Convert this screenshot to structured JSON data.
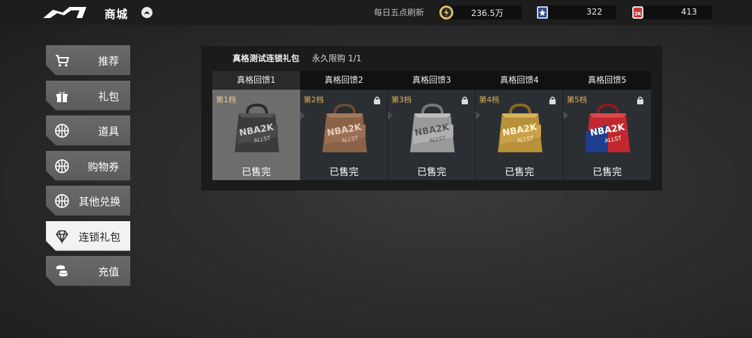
{
  "header": {
    "title": "商城",
    "refresh_text": "每日五点刷新",
    "currencies": [
      {
        "icon": "gold-coin-icon",
        "value": "236.5万"
      },
      {
        "icon": "allstar-token-icon",
        "value": "322"
      },
      {
        "icon": "2k-coin-icon",
        "value": "413"
      }
    ]
  },
  "sidebar": {
    "items": [
      {
        "label": "推荐",
        "icon": "cart-icon"
      },
      {
        "label": "礼包",
        "icon": "gift-icon"
      },
      {
        "label": "道具",
        "icon": "basketball-icon"
      },
      {
        "label": "购物券",
        "icon": "basketball-icon"
      },
      {
        "label": "其他兑换",
        "icon": "basketball-icon"
      },
      {
        "label": "连锁礼包",
        "icon": "diamond-icon",
        "active": true
      },
      {
        "label": "充值",
        "icon": "coins-icon"
      }
    ]
  },
  "panel": {
    "title": "真格测试连锁礼包",
    "limit": "永久限购 1/1",
    "tiers": [
      {
        "name": "真格回馈1",
        "tier_label": "第1档",
        "status": "已售完",
        "locked": false,
        "color": "#3a3a3a"
      },
      {
        "name": "真格回馈2",
        "tier_label": "第2档",
        "status": "已售完",
        "locked": true,
        "color": "#8a6248"
      },
      {
        "name": "真格回馈3",
        "tier_label": "第3档",
        "status": "已售完",
        "locked": true,
        "color": "#9a9a9a"
      },
      {
        "name": "真格回馈4",
        "tier_label": "第4档",
        "status": "已售完",
        "locked": true,
        "color": "#b8903a"
      },
      {
        "name": "真格回馈5",
        "tier_label": "第5档",
        "status": "已售完",
        "locked": true,
        "color": "#c0282d"
      }
    ]
  }
}
